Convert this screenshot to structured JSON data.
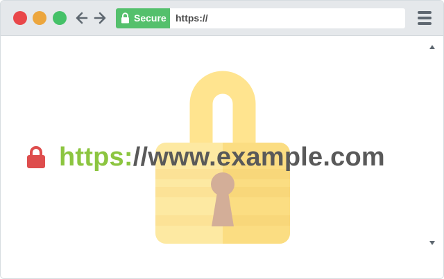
{
  "browser": {
    "window_controls": [
      {
        "name": "close",
        "color": "#e9474a"
      },
      {
        "name": "minimize",
        "color": "#eca63e"
      },
      {
        "name": "maximize",
        "color": "#45c168"
      }
    ],
    "nav": {
      "back_icon": "arrow-left-icon",
      "forward_icon": "arrow-right-icon"
    },
    "address_bar": {
      "secure_label": "Secure",
      "secure_color": "#54c06c",
      "secure_icon": "lock-icon",
      "url_value": "https://"
    },
    "menu_icon": "hamburger-menu-icon"
  },
  "content": {
    "url_scheme": "https:",
    "url_rest": "//www.example.com",
    "scheme_color": "#8cc540",
    "rest_color": "#595959",
    "small_lock_color": "#de4d4d",
    "big_lock_icon": "padlock-illustration",
    "big_lock_colors": {
      "shackle": "#ffe48f",
      "body_light": "#fde9a2",
      "body_dark": "#fbdd82",
      "keyhole": "#d3ae98"
    }
  },
  "scrollbar": {
    "up_icon": "triangle-up-icon",
    "down_icon": "triangle-down-icon"
  }
}
